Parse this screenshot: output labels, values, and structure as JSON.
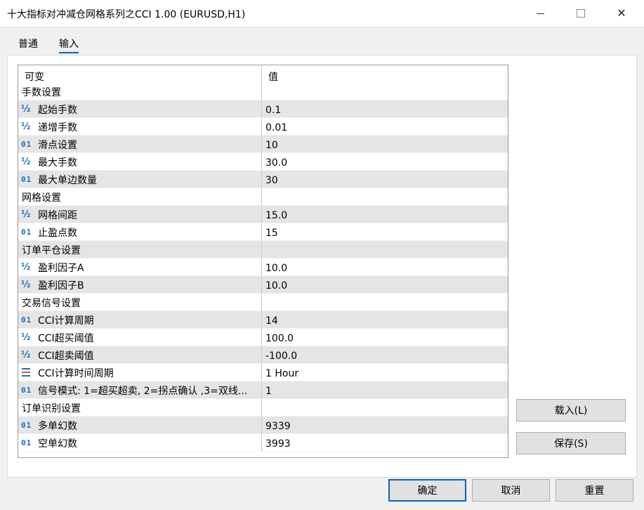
{
  "window": {
    "title": "十大指标对冲减仓网格系列之CCI 1.00 (EURUSD,H1)",
    "minimize_glyph": "—",
    "maximize_glyph": "☐",
    "close_glyph": "✕"
  },
  "tabs": [
    {
      "label": "普通",
      "active": false
    },
    {
      "label": "输入",
      "active": true
    }
  ],
  "grid": {
    "headers": {
      "name": "可变",
      "value": "值"
    },
    "rows": [
      {
        "type": "group",
        "name": "手数设置",
        "value": ""
      },
      {
        "type": "double",
        "icon": "half-icon",
        "name": "起始手数",
        "value": "0.1"
      },
      {
        "type": "double",
        "icon": "half-icon",
        "name": "递增手数",
        "value": "0.01"
      },
      {
        "type": "int",
        "icon": "int-icon",
        "name": "滑点设置",
        "value": "10"
      },
      {
        "type": "double",
        "icon": "half-icon",
        "name": "最大手数",
        "value": "30.0"
      },
      {
        "type": "int",
        "icon": "int-icon",
        "name": "最大单边数量",
        "value": "30"
      },
      {
        "type": "group",
        "name": "网格设置",
        "value": ""
      },
      {
        "type": "double",
        "icon": "half-icon",
        "name": "网格间距",
        "value": "15.0"
      },
      {
        "type": "int",
        "icon": "int-icon",
        "name": "止盈点数",
        "value": "15"
      },
      {
        "type": "group",
        "name": "订单平仓设置",
        "value": ""
      },
      {
        "type": "double",
        "icon": "half-icon",
        "name": "盈利因子A",
        "value": "10.0"
      },
      {
        "type": "double",
        "icon": "half-icon",
        "name": "盈利因子B",
        "value": "10.0"
      },
      {
        "type": "group",
        "name": "交易信号设置",
        "value": ""
      },
      {
        "type": "int",
        "icon": "int-icon",
        "name": "CCI计算周期",
        "value": "14"
      },
      {
        "type": "double",
        "icon": "half-icon",
        "name": "CCI超买阈值",
        "value": "100.0"
      },
      {
        "type": "double",
        "icon": "half-icon",
        "name": "CCI超卖阈值",
        "value": "-100.0"
      },
      {
        "type": "enum",
        "icon": "enum-icon",
        "name": "CCI计算时间周期",
        "value": "1 Hour"
      },
      {
        "type": "int",
        "icon": "int-icon",
        "name": "信号模式: 1=超买超卖, 2=拐点确认 ,3=双线...",
        "value": "1"
      },
      {
        "type": "group",
        "name": "订单识别设置",
        "value": ""
      },
      {
        "type": "int",
        "icon": "int-icon",
        "name": "多单幻数",
        "value": "9339"
      },
      {
        "type": "int",
        "icon": "int-icon",
        "name": "空单幻数",
        "value": "3993"
      }
    ]
  },
  "icons": {
    "int": "01",
    "double": "½"
  },
  "buttons": {
    "load": "载入(L)",
    "save": "保存(S)",
    "ok": "确定",
    "cancel": "取消",
    "reset": "重置"
  },
  "colors": {
    "accent": "#0a64b6",
    "icon": "#1f6fb8",
    "row_alt": "#e5e5e5"
  }
}
